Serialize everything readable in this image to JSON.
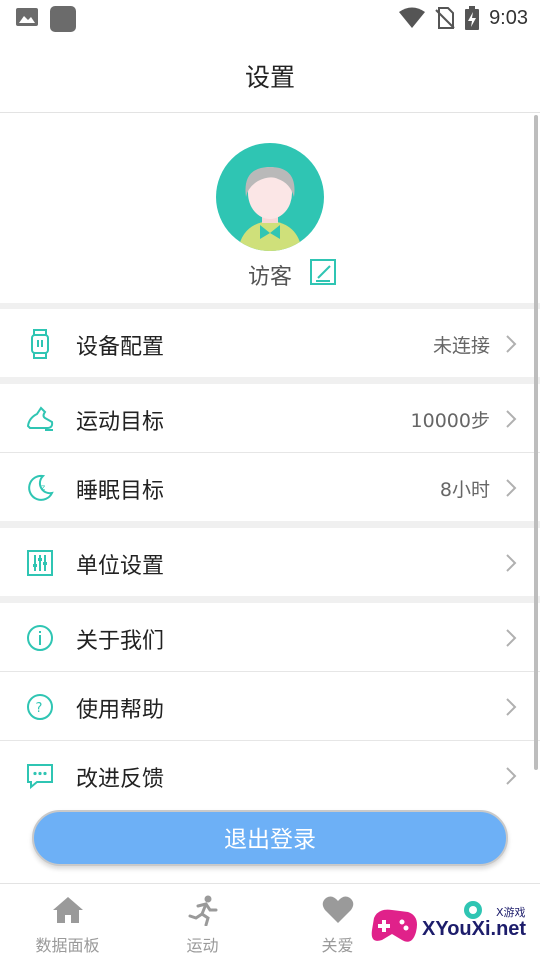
{
  "status_bar": {
    "time": "9:03"
  },
  "header": {
    "title": "设置"
  },
  "profile": {
    "username": "访客"
  },
  "menu": {
    "device_config": {
      "label": "设备配置",
      "value": "未连接"
    },
    "sport_goal": {
      "label": "运动目标",
      "value": "10000步"
    },
    "sleep_goal": {
      "label": "睡眠目标",
      "value": "8小时"
    },
    "unit_settings": {
      "label": "单位设置"
    },
    "about_us": {
      "label": "关于我们"
    },
    "help": {
      "label": "使用帮助"
    },
    "feedback": {
      "label": "改进反馈"
    }
  },
  "logout": {
    "label": "退出登录"
  },
  "tabs": [
    {
      "label": "数据面板",
      "icon": "home-icon"
    },
    {
      "label": "运动",
      "icon": "running-icon"
    },
    {
      "label": "关爱",
      "icon": "heart-icon"
    },
    {
      "label": "",
      "icon": "gear-icon"
    }
  ],
  "watermark": {
    "text": "XYouXi.net",
    "small": "X游戏"
  },
  "colors": {
    "accent": "#2fc5b3",
    "button": "#6db0f6",
    "muted": "#9a9a9a"
  }
}
